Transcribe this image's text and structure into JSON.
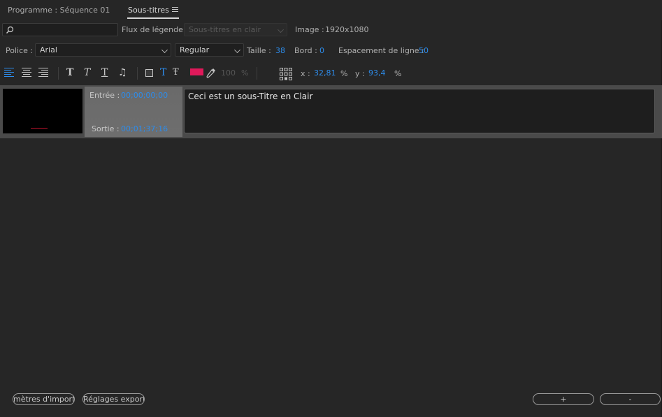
{
  "tabs": [
    {
      "label": "Programme : Séquence 01",
      "active": false
    },
    {
      "label": "Sous-titres",
      "active": true
    }
  ],
  "search": {
    "placeholder": ""
  },
  "row1": {
    "stream_label": "Flux de légende :",
    "stream_value": "Sous-titres en clair",
    "image_label": "Image :",
    "image_value": "1920x1080"
  },
  "row2": {
    "font_label": "Police :",
    "font_value": "Arial",
    "style_value": "Regular",
    "size_label": "Taille :",
    "size_value": "38",
    "border_label": "Bord :",
    "border_value": "0",
    "spacing_label": "Espacement de ligne :",
    "spacing_value": "50"
  },
  "toolbar": {
    "opacity_value": "100",
    "opacity_unit": "%",
    "x_label": "x :",
    "x_value": "32,81",
    "x_unit": "%",
    "y_label": "y :",
    "y_value": "93,4",
    "y_unit": "%",
    "color_swatch": "#e0195a",
    "accent": "#2d8ceb"
  },
  "caption": {
    "in_label": "Entrée :",
    "in_value": "00;00;00;00",
    "out_label": "Sortie :",
    "out_value": "00;01;37;16",
    "text": "Ceci est un sous-Titre en Clair"
  },
  "footer": {
    "import_button": "mètres d'importa",
    "export_button": "Réglages export.",
    "add_button": "+",
    "remove_button": "-"
  }
}
